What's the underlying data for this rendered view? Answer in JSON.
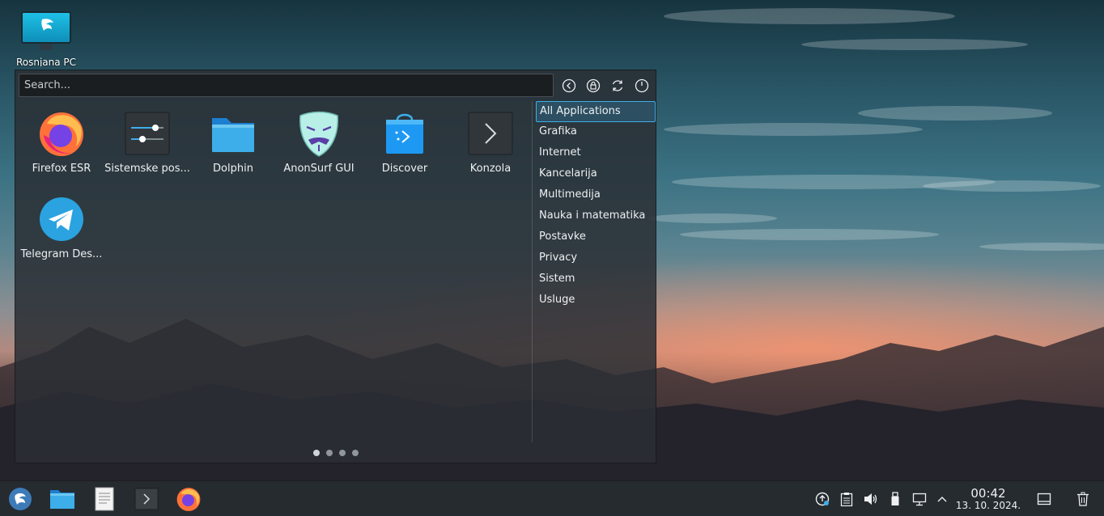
{
  "desktop": {
    "icon_label": "Rosnjana PC"
  },
  "launcher": {
    "search_placeholder": "Search...",
    "actions": [
      "back-icon",
      "lock-icon",
      "refresh-icon",
      "power-icon"
    ],
    "apps": [
      {
        "name": "Firefox ESR",
        "icon": "firefox-icon"
      },
      {
        "name": "Sistemske pos...",
        "icon": "system-settings-icon"
      },
      {
        "name": "Dolphin",
        "icon": "folder-icon"
      },
      {
        "name": "AnonSurf GUI",
        "icon": "anonsurf-mask-icon"
      },
      {
        "name": "Discover",
        "icon": "discover-bag-icon"
      },
      {
        "name": "Konzola",
        "icon": "terminal-icon"
      },
      {
        "name": "Telegram Des...",
        "icon": "telegram-icon"
      }
    ],
    "categories": [
      "All Applications",
      "Grafika",
      "Internet",
      "Kancelarija",
      "Multimedija",
      "Nauka i matematika",
      "Postavke",
      "Privacy",
      "Sistem",
      "Usluge"
    ],
    "active_category": "All Applications",
    "pages": 4,
    "current_page": 1
  },
  "taskbar": {
    "items": [
      "app-launcher-icon",
      "folder-icon",
      "text-editor-icon",
      "terminal-icon",
      "firefox-icon"
    ],
    "tray": [
      "update-icon",
      "clipboard-icon",
      "volume-icon",
      "usb-icon",
      "network-icon",
      "expand-arrow-icon"
    ],
    "clock": {
      "time": "00:42",
      "date": "13. 10. 2024."
    },
    "extra": [
      "show-desktop-icon",
      "trash-icon"
    ]
  },
  "colors": {
    "accent": "#3daee9",
    "panel": "#262b30"
  }
}
